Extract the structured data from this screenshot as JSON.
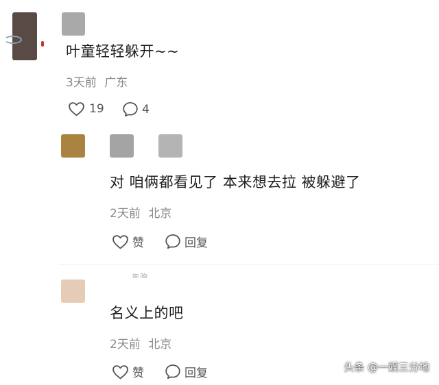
{
  "comments": [
    {
      "text": "叶童轻轻躲开~~",
      "time": "3天前",
      "location": "广东",
      "like_count": "19",
      "reply_count": "4"
    }
  ],
  "replies": [
    {
      "text": "对 咱俩都看见了 本来想去拉 被躲避了",
      "time": "2天前",
      "location": "北京",
      "like_label": "赞",
      "reply_label": "回复"
    },
    {
      "text": "名义上的吧",
      "time": "2天前",
      "location": "北京",
      "like_label": "赞",
      "reply_label": "回复"
    }
  ],
  "truncated_fragment": "年驹",
  "watermark": "头条 @一娱三分地",
  "colors": {
    "avatar_main": "#5a4a46",
    "avatar_gray": "#a9a9a9",
    "avatar_brown": "#a9833f",
    "avatar_beige": "#e6ccb6",
    "meta_text": "#8a8a8a"
  },
  "icons": [
    "heart-icon",
    "comment-icon"
  ]
}
